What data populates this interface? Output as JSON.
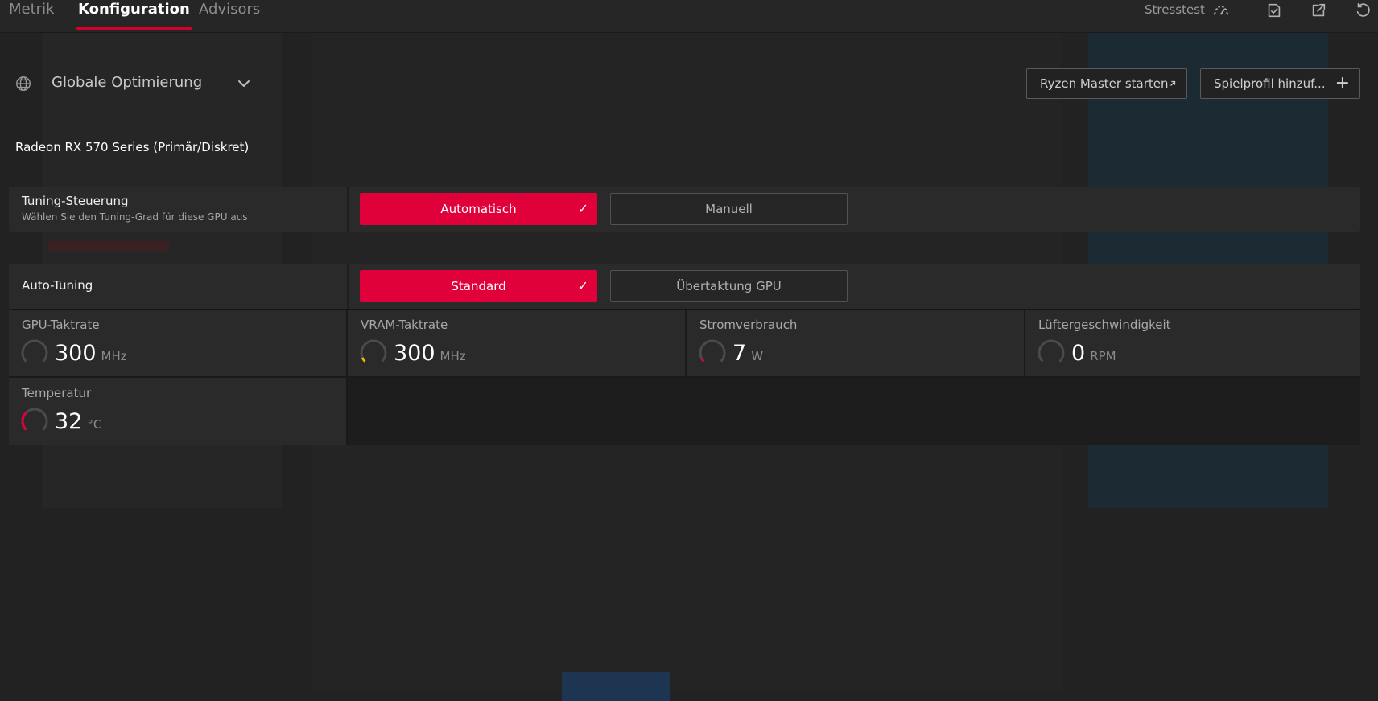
{
  "tabs": [
    {
      "label": "Metrik",
      "active": false
    },
    {
      "label": "Konfiguration",
      "active": true
    },
    {
      "label": "Advisors",
      "active": false
    }
  ],
  "toolbar": {
    "stress_label": "Stresstest",
    "icons": [
      "stresstest-gauge-icon",
      "checklist-icon",
      "export-icon",
      "reset-icon"
    ]
  },
  "profile": {
    "label": "Globale Optimierung",
    "icon": "globe-icon"
  },
  "actions": {
    "ryzen_label": "Ryzen Master starten",
    "spielprofil_label": "Spielprofil hinzuf..."
  },
  "gpu": {
    "name": "Radeon RX 570 Series (Primär/Diskret)"
  },
  "tuning": {
    "title": "Tuning-Steuerung",
    "subtitle": "Wählen Sie den Tuning-Grad für diese GPU aus",
    "options": [
      {
        "label": "Automatisch",
        "selected": true
      },
      {
        "label": "Manuell",
        "selected": false
      }
    ]
  },
  "auto_tuning": {
    "title": "Auto-Tuning",
    "options": [
      {
        "label": "Standard",
        "selected": true
      },
      {
        "label": "Übertaktung GPU",
        "selected": false
      }
    ]
  },
  "metrics": [
    {
      "label": "GPU-Taktrate",
      "value": "300",
      "unit": "MHz",
      "gauge_fraction": 0.0,
      "gauge_color": "#555555"
    },
    {
      "label": "VRAM-Taktrate",
      "value": "300",
      "unit": "MHz",
      "gauge_fraction": 0.08,
      "gauge_color": "#f0b400"
    },
    {
      "label": "Stromverbrauch",
      "value": "7",
      "unit": "W",
      "gauge_fraction": 0.06,
      "gauge_color": "#e0003a"
    },
    {
      "label": "Lüftergeschwindigkeit",
      "value": "0",
      "unit": "RPM",
      "gauge_fraction": 0.0,
      "gauge_color": "#555555"
    },
    {
      "label": "Temperatur",
      "value": "32",
      "unit": "°C",
      "gauge_fraction": 0.35,
      "gauge_color": "#e0003a"
    }
  ],
  "colors": {
    "accent": "#e0003a",
    "background": "#1f1f1f",
    "panel": "#2a2a2a"
  }
}
